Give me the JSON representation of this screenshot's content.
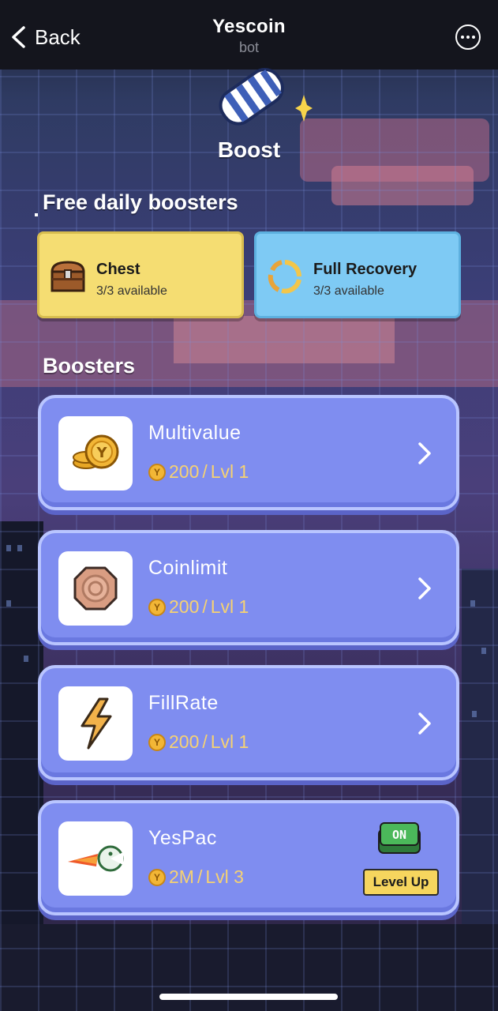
{
  "topbar": {
    "back_label": "Back",
    "title": "Yescoin",
    "subtitle": "bot"
  },
  "page": {
    "heading": "Boost"
  },
  "free_daily": {
    "title": "Free daily boosters",
    "items": [
      {
        "name": "Chest",
        "availability": "3/3 available",
        "icon": "chest-icon",
        "color": "#f5dd72"
      },
      {
        "name": "Full Recovery",
        "availability": "3/3 available",
        "icon": "recovery-icon",
        "color": "#7ecaf4"
      }
    ]
  },
  "boosters": {
    "title": "Boosters",
    "items": [
      {
        "name": "Multivalue",
        "price": "200",
        "level": "Lvl 1",
        "icon": "coin-stack-icon"
      },
      {
        "name": "Coinlimit",
        "price": "200",
        "level": "Lvl 1",
        "icon": "coin-plate-icon"
      },
      {
        "name": "FillRate",
        "price": "200",
        "level": "Lvl 1",
        "icon": "lightning-icon"
      },
      {
        "name": "YesPac",
        "price": "2M",
        "level": "Lvl 3",
        "icon": "yespac-icon",
        "toggle_label": "ON",
        "action_label": "Level Up"
      }
    ],
    "separator": " / "
  },
  "colors": {
    "card": "#7f8df0",
    "price": "#f6d272",
    "level_up": "#f6d55e",
    "toggle": "#4bb85a"
  }
}
